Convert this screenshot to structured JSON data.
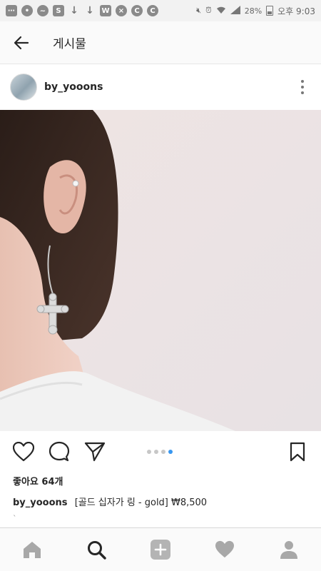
{
  "status_bar": {
    "icons": [
      "message-icon",
      "chat-icon",
      "messenger-icon",
      "s-icon",
      "download-icon",
      "download-icon",
      "w-icon",
      "close-circle-icon",
      "c-icon",
      "c-icon"
    ],
    "battery": "28%",
    "time": "오후 9:03"
  },
  "header": {
    "title": "게시물"
  },
  "post": {
    "username": "by_yooons",
    "likes": "좋아요 64개",
    "caption_user": "by_yooons",
    "caption_text": "[골드 십자가 링 - gold] ₩8,500",
    "extra": "`"
  },
  "carousel": {
    "count": 4,
    "active_index": 3
  },
  "colors": {
    "accent": "#3897f0",
    "icon": "#262626",
    "nav_icon": "#9b9b9b"
  }
}
